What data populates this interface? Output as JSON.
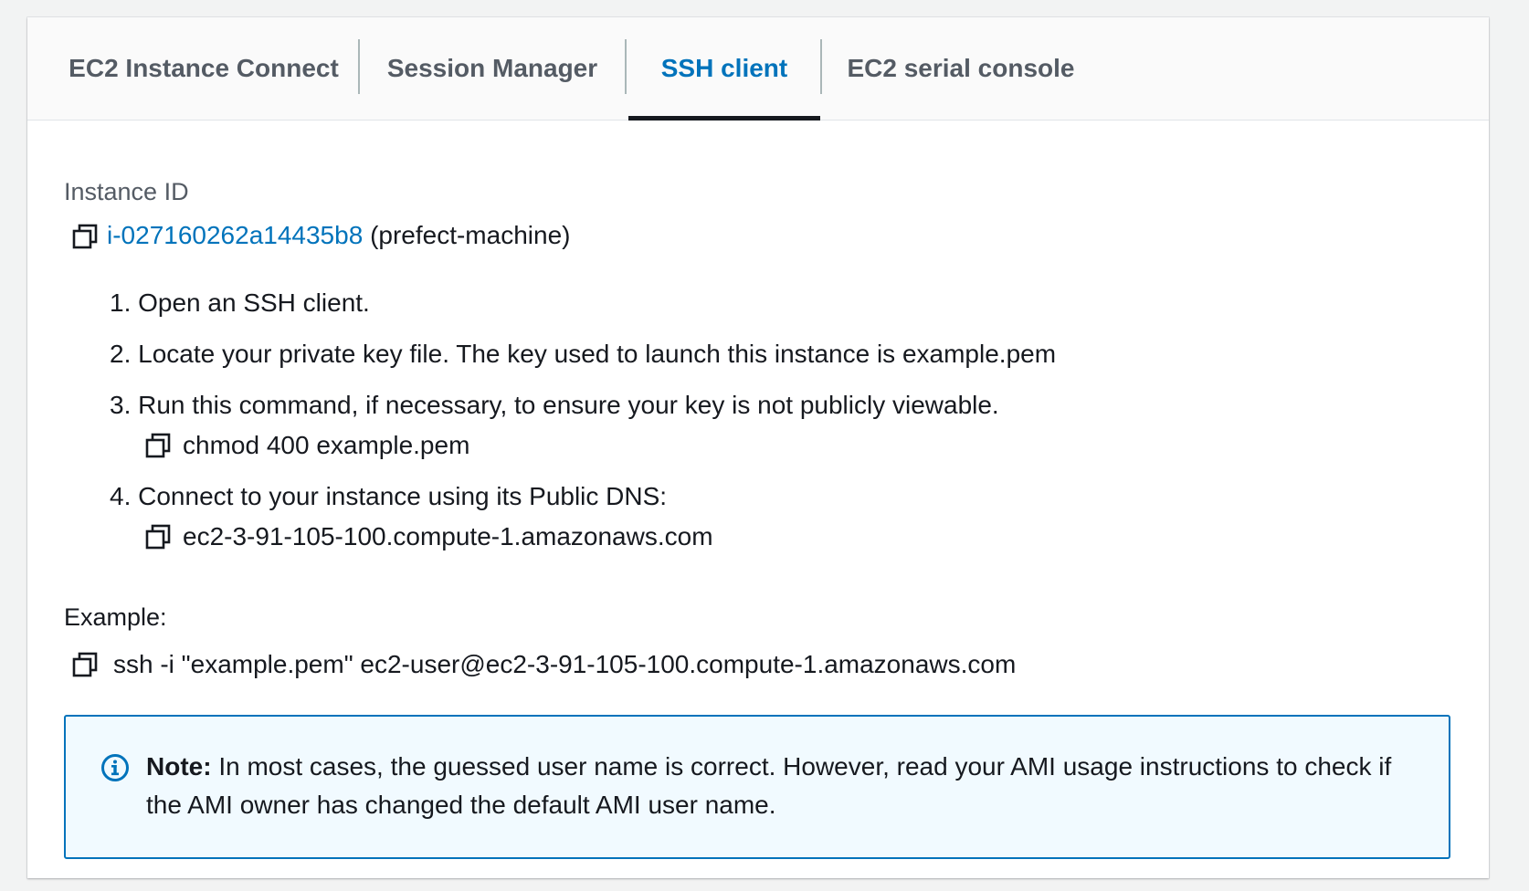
{
  "tabs": [
    {
      "label": "EC2 Instance Connect",
      "active": false
    },
    {
      "label": "Session Manager",
      "active": false
    },
    {
      "label": "SSH client",
      "active": true
    },
    {
      "label": "EC2 serial console",
      "active": false
    }
  ],
  "instance": {
    "label": "Instance ID",
    "id": "i-027160262a14435b8",
    "name": "(prefect-machine)"
  },
  "steps": [
    {
      "text": "1. Open an SSH client."
    },
    {
      "text": "2. Locate your private key file. The key used to launch this instance is example.pem"
    },
    {
      "text": "3. Run this command, if necessary, to ensure your key is not publicly viewable.",
      "command": "chmod 400 example.pem"
    },
    {
      "text": "4. Connect to your instance using its Public DNS:",
      "command": "ec2-3-91-105-100.compute-1.amazonaws.com"
    }
  ],
  "example": {
    "label": "Example:",
    "command": "ssh -i \"example.pem\" ec2-user@ec2-3-91-105-100.compute-1.amazonaws.com"
  },
  "note": {
    "bold": "Note:",
    "text": " In most cases, the guessed user name is correct. However, read your AMI usage instructions to check if the AMI owner has changed the default AMI user name."
  },
  "colors": {
    "accent": "#0073bb",
    "text": "#16191f",
    "muted": "#545b64",
    "note_bg": "#f1faff"
  },
  "icons": {
    "copy": "copy-icon",
    "info": "info-icon"
  }
}
